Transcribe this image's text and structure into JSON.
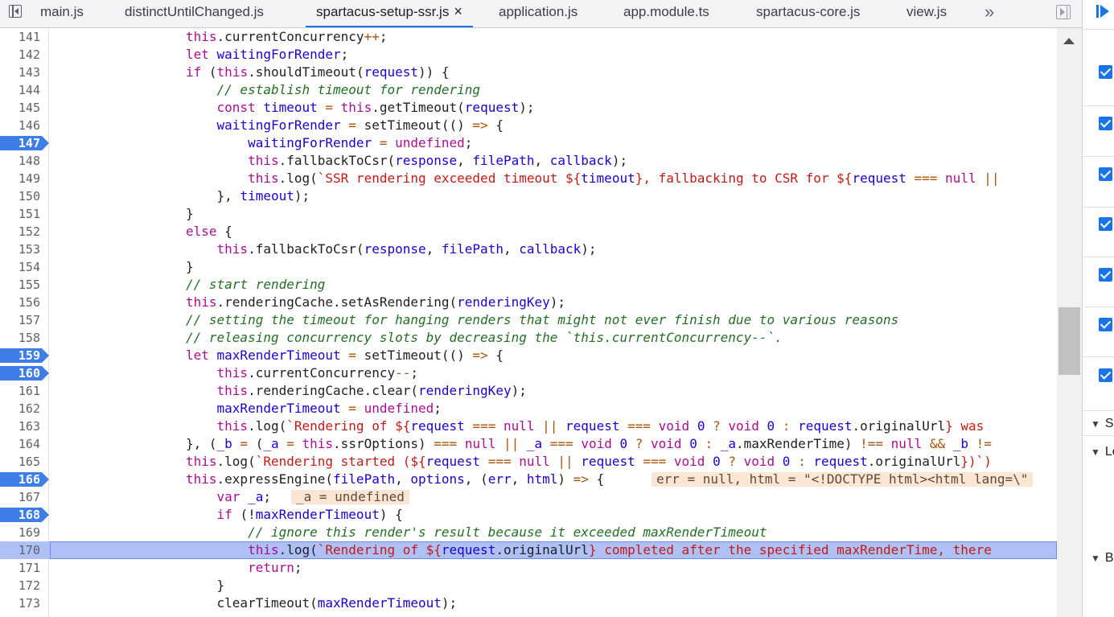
{
  "tabs": [
    {
      "label": "main.js",
      "active": false
    },
    {
      "label": "distinctUntilChanged.js",
      "active": false
    },
    {
      "label": "spartacus-setup-ssr.js",
      "active": true
    },
    {
      "label": "application.js",
      "active": false
    },
    {
      "label": "app.module.ts",
      "active": false
    },
    {
      "label": "spartacus-core.js",
      "active": false
    },
    {
      "label": "view.js",
      "active": false
    }
  ],
  "close_glyph": "×",
  "more_tabs_glyph": "»",
  "lines": [
    {
      "n": "141",
      "bp": false
    },
    {
      "n": "142",
      "bp": false
    },
    {
      "n": "143",
      "bp": false
    },
    {
      "n": "144",
      "bp": false
    },
    {
      "n": "145",
      "bp": false
    },
    {
      "n": "146",
      "bp": false
    },
    {
      "n": "147",
      "bp": true
    },
    {
      "n": "148",
      "bp": false
    },
    {
      "n": "149",
      "bp": false
    },
    {
      "n": "150",
      "bp": false
    },
    {
      "n": "151",
      "bp": false
    },
    {
      "n": "152",
      "bp": false
    },
    {
      "n": "153",
      "bp": false
    },
    {
      "n": "154",
      "bp": false
    },
    {
      "n": "155",
      "bp": false
    },
    {
      "n": "156",
      "bp": false
    },
    {
      "n": "157",
      "bp": false
    },
    {
      "n": "158",
      "bp": false
    },
    {
      "n": "159",
      "bp": true
    },
    {
      "n": "160",
      "bp": true
    },
    {
      "n": "161",
      "bp": false
    },
    {
      "n": "162",
      "bp": false
    },
    {
      "n": "163",
      "bp": false
    },
    {
      "n": "164",
      "bp": false
    },
    {
      "n": "165",
      "bp": false
    },
    {
      "n": "166",
      "bp": true
    },
    {
      "n": "167",
      "bp": false
    },
    {
      "n": "168",
      "bp": true
    },
    {
      "n": "169",
      "bp": false
    },
    {
      "n": "170",
      "bp": false,
      "current": true
    },
    {
      "n": "171",
      "bp": false
    },
    {
      "n": "172",
      "bp": false
    },
    {
      "n": "173",
      "bp": false
    }
  ],
  "inline_values": {
    "line166": "err = null, html = \"<!DOCTYPE html><html lang=\\\"",
    "line167": "_a = undefined"
  },
  "right_panel": {
    "checkbox_count": 7,
    "sections": [
      "S",
      "Lo",
      "B"
    ]
  },
  "colors": {
    "keyword": "#aa0d91",
    "variable": "#1c00cf",
    "ident": "#3c46b4",
    "string": "#c41a16",
    "comment": "#236e25",
    "operator": "#a8540a",
    "breakpoint": "#3d7ee8",
    "exec_line": "#aec0f5"
  }
}
